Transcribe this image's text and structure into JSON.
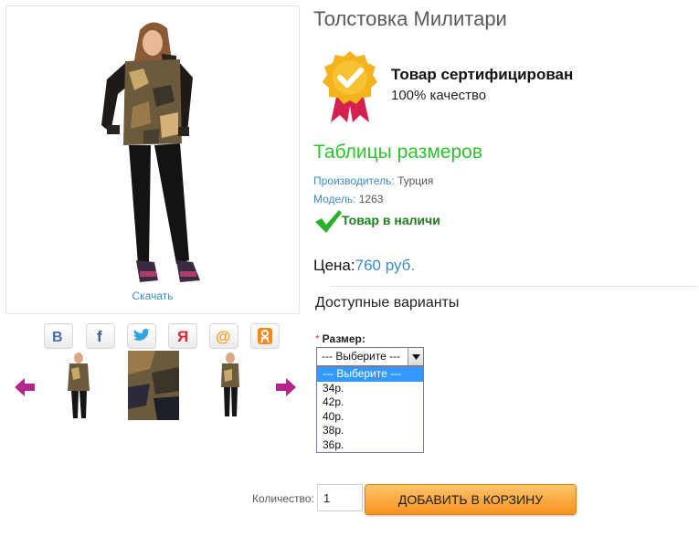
{
  "product": {
    "title": "Толстовка Милитари",
    "download_label": "Скачать"
  },
  "certificate": {
    "title": "Товар сертифицирован",
    "subtitle": "100% качество"
  },
  "size_table_label": "Таблицы размеров",
  "manufacturer": {
    "label": "Производитель:",
    "value": "Турция"
  },
  "model": {
    "label": "Модель:",
    "value": "1263"
  },
  "stock_status": "Товар в наличи",
  "price": {
    "label": "Цена:",
    "value": "760 руб."
  },
  "options": {
    "heading": "Доступные варианты",
    "required_mark": "*",
    "size_label": "Размер:",
    "selected": "--- Выберите ---",
    "items": [
      "--- Выберите ---",
      "34р.",
      "42р.",
      "40р.",
      "38р.",
      "36р."
    ]
  },
  "quantity": {
    "label": "Количество:",
    "value": "1"
  },
  "cart_button_label": "ДОБАВИТЬ В КОРЗИНУ",
  "share_icons": [
    "vk-icon",
    "facebook-icon",
    "twitter-icon",
    "yandex-icon",
    "mail-ru-icon",
    "odnoklassniki-icon"
  ],
  "colors": {
    "link": "#3b8dbd",
    "size_table": "#2ec22e",
    "stock": "#1e7d1e",
    "cart_button": "#f7931e",
    "dropdown_selected": "#3399ff",
    "nav_arrow": "#b5258b"
  }
}
